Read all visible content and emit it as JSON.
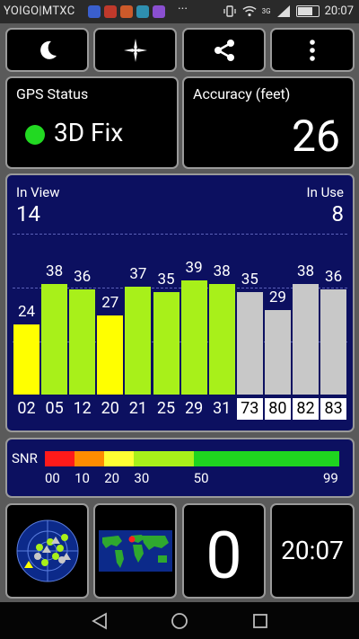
{
  "status_bar": {
    "carrier": "YOIGO|MTXC",
    "overflow": "···",
    "network": "3G",
    "time": "20:07",
    "app_icon_colors": [
      "#3a5fcd",
      "#c0392b",
      "#cc5a2a",
      "#2e8fb0",
      "#8a4fd0"
    ]
  },
  "toolbar": {
    "night_mode_icon": "moon-icon",
    "compass_icon": "compass-icon",
    "share_icon": "share-icon",
    "menu_icon": "more-vert-icon"
  },
  "gps_status": {
    "title": "GPS Status",
    "value": "3D Fix",
    "indicator_color": "#22d922"
  },
  "accuracy": {
    "title": "Accuracy (feet)",
    "value": "26"
  },
  "satellites": {
    "in_view_label": "In View",
    "in_view": "14",
    "in_use_label": "In Use",
    "in_use": "8",
    "scale_max": 45,
    "items": [
      {
        "prn": "02",
        "snr": 24,
        "used": true
      },
      {
        "prn": "05",
        "snr": 38,
        "used": true
      },
      {
        "prn": "12",
        "snr": 36,
        "used": true
      },
      {
        "prn": "20",
        "snr": 27,
        "used": true
      },
      {
        "prn": "21",
        "snr": 37,
        "used": true
      },
      {
        "prn": "25",
        "snr": 35,
        "used": true
      },
      {
        "prn": "29",
        "snr": 39,
        "used": true
      },
      {
        "prn": "31",
        "snr": 38,
        "used": true
      },
      {
        "prn": "73",
        "snr": 35,
        "used": false
      },
      {
        "prn": "80",
        "snr": 29,
        "used": false
      },
      {
        "prn": "82",
        "snr": 38,
        "used": false
      },
      {
        "prn": "83",
        "snr": 36,
        "used": false
      }
    ]
  },
  "snr_legend": {
    "label": "SNR",
    "segments": [
      {
        "from": 0,
        "to": 10,
        "color": "#ff1a1a"
      },
      {
        "from": 10,
        "to": 20,
        "color": "#ff8c00"
      },
      {
        "from": 20,
        "to": 30,
        "color": "#ffff33"
      },
      {
        "from": 30,
        "to": 50,
        "color": "#a8f01a"
      },
      {
        "from": 50,
        "to": 99,
        "color": "#1fd41f"
      }
    ],
    "ticks": [
      "00",
      "10",
      "20",
      "30",
      "50",
      "99"
    ]
  },
  "bottom": {
    "radar_icon": "sky-radar-icon",
    "map_icon": "world-map-icon",
    "big_value": "0",
    "clock": "20:07"
  },
  "nav": {
    "back_icon": "back-triangle-icon",
    "home_icon": "home-circle-icon",
    "recents_icon": "recents-square-icon"
  },
  "colors": {
    "used_bar_strong": "#a8f01a",
    "used_bar_weak": "#ffff00",
    "unused_bar": "#c8c8c8",
    "panel_bg": "#0c1060"
  }
}
